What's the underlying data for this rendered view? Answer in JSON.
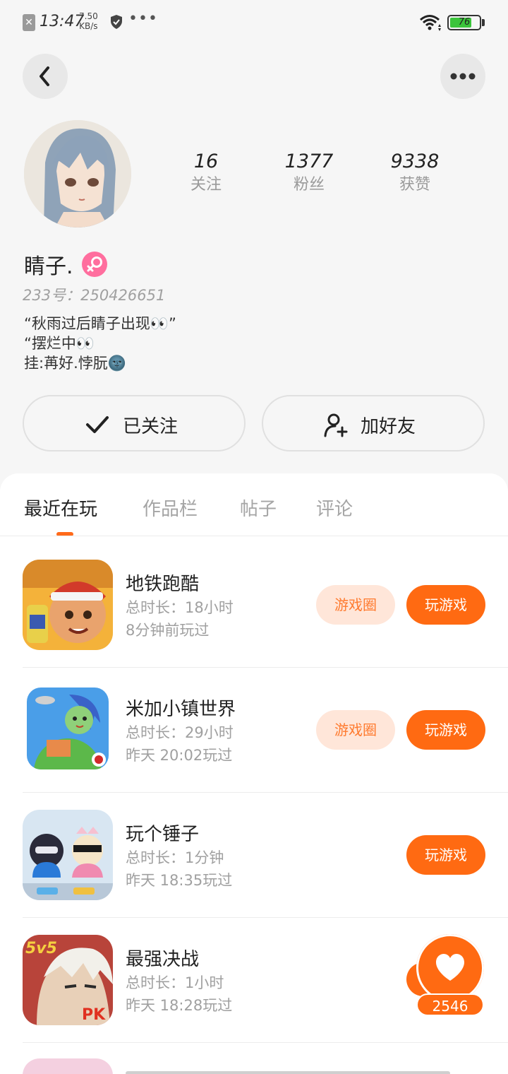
{
  "status_bar": {
    "time": "13:47",
    "speed_value": "7.50",
    "speed_unit": "KB/s",
    "battery": "76",
    "battery_level": 0.76,
    "battery_color": "#3bc43b"
  },
  "header": {
    "back_icon": "chevron-left-icon",
    "more_icon": "more-dots-icon"
  },
  "profile": {
    "name": "睛子.",
    "gender_icon": "female-icon",
    "uid_label": "233号：",
    "uid": "250426651",
    "bio": [
      "“秋雨过后睛子出现👀”",
      "“摆烂中👀",
      "挂:苒好.悖朊🌚"
    ],
    "stats": [
      {
        "value": "16",
        "label": "关注"
      },
      {
        "value": "1377",
        "label": "粉丝"
      },
      {
        "value": "9338",
        "label": "获赞"
      }
    ]
  },
  "actions": {
    "follow_label": "已关注",
    "add_friend_label": "加好友"
  },
  "tabs": [
    "最近在玩",
    "作品栏",
    "帖子",
    "评论"
  ],
  "active_tab": 0,
  "games": [
    {
      "name": "地铁跑酷",
      "duration": "总时长：18小时",
      "last_played": "8分钟前玩过",
      "circle_label": "游戏圈",
      "play_label": "玩游戏"
    },
    {
      "name": "米加小镇世界",
      "duration": "总时长：29小时",
      "last_played": "昨天 20:02玩过",
      "circle_label": "游戏圈",
      "play_label": "玩游戏"
    },
    {
      "name": "玩个锤子",
      "duration": "总时长：1分钟",
      "last_played": "昨天 18:35玩过",
      "circle_label": "",
      "play_label": "玩游戏"
    },
    {
      "name": "最强决战",
      "duration": "总时长：1小时",
      "last_played": "昨天 18:28玩过",
      "circle_label": "",
      "play_label": ""
    }
  ],
  "like_float": {
    "count": "2546",
    "icon": "heart-icon"
  },
  "colors": {
    "accent": "#ff6a12",
    "accent_light": "#ffe6d9",
    "gender": "#ff6e9e"
  }
}
